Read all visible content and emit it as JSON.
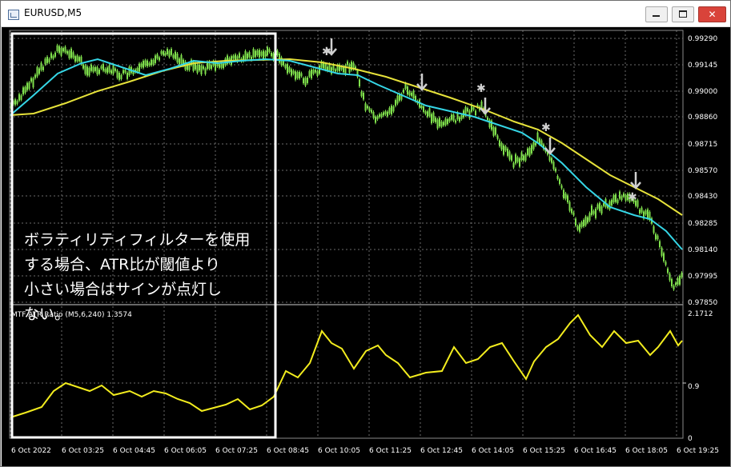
{
  "window": {
    "title": "EURUSD,M5",
    "close_glyph": "✕"
  },
  "main_chart": {
    "price_ticks": [
      "0.99290",
      "0.99145",
      "0.99000",
      "0.98860",
      "0.98715",
      "0.98570",
      "0.98430",
      "0.98285",
      "0.98140",
      "0.97995",
      "0.97850"
    ]
  },
  "indicator": {
    "label": "MTF ATR Ratio  (M5,6,240) 1.3574",
    "scale_ticks": [
      "2.1712",
      "0.9",
      "0"
    ]
  },
  "time_axis": {
    "labels": [
      "6 Oct 2022",
      "6 Oct 03:25",
      "6 Oct 04:45",
      "6 Oct 06:05",
      "6 Oct 07:25",
      "6 Oct 08:45",
      "6 Oct 10:05",
      "6 Oct 11:25",
      "6 Oct 12:45",
      "6 Oct 14:05",
      "6 Oct 15:25",
      "6 Oct 16:45",
      "6 Oct 18:05",
      "6 Oct 19:25"
    ]
  },
  "annotation": {
    "lines": [
      "ボラティリティフィルターを使用",
      "する場合、ATR比が閾値より",
      "小さい場合はサインが点灯し",
      "ない。"
    ]
  },
  "colors": {
    "background": "#000000",
    "candles": "#7fe04c",
    "ma_fast": "#35d6e6",
    "ma_slow": "#e6e23a",
    "atr_line": "#f2ec1e",
    "grid": "#6b6b6b",
    "highlight_box": "#ffffff",
    "signal_marks": "#d0d0d0",
    "text": "#ffffff"
  },
  "icons": {
    "app": "chart-window-icon",
    "signal_arrow": "arrow-down-icon",
    "signal_star": "star-icon"
  }
}
